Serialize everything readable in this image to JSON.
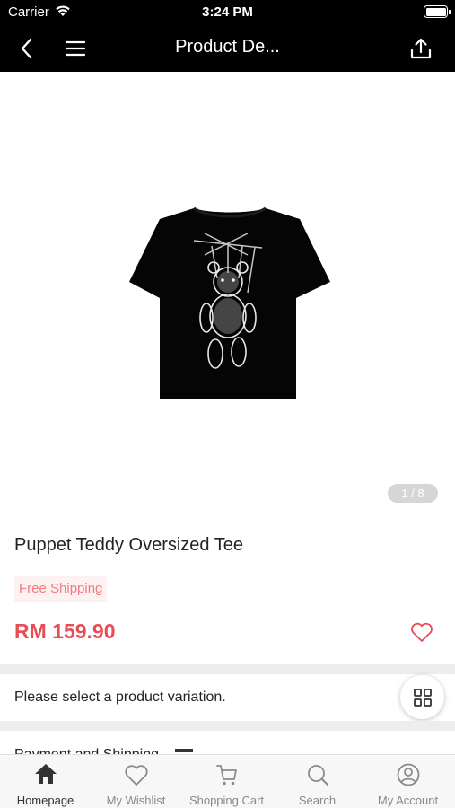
{
  "status_bar": {
    "carrier": "Carrier",
    "time": "3:24 PM"
  },
  "nav": {
    "title": "Product De..."
  },
  "gallery": {
    "counter": "1 / 8"
  },
  "product": {
    "title": "Puppet Teddy Oversized Tee",
    "badge": "Free Shipping",
    "price": "RM 159.90"
  },
  "variation": {
    "prompt": "Please select a product variation."
  },
  "payment": {
    "label": "Payment and Shipping"
  },
  "tabs": [
    {
      "label": "Homepage",
      "icon": "home-icon",
      "active": true
    },
    {
      "label": "My Wishlist",
      "icon": "heart-icon"
    },
    {
      "label": "Shopping Cart",
      "icon": "cart-icon"
    },
    {
      "label": "Search",
      "icon": "search-icon"
    },
    {
      "label": "My Account",
      "icon": "account-icon"
    }
  ],
  "colors": {
    "price": "#e84c55",
    "badge_text": "#f27c80",
    "badge_bg": "#fdf1f1",
    "topbar": "#000000"
  }
}
